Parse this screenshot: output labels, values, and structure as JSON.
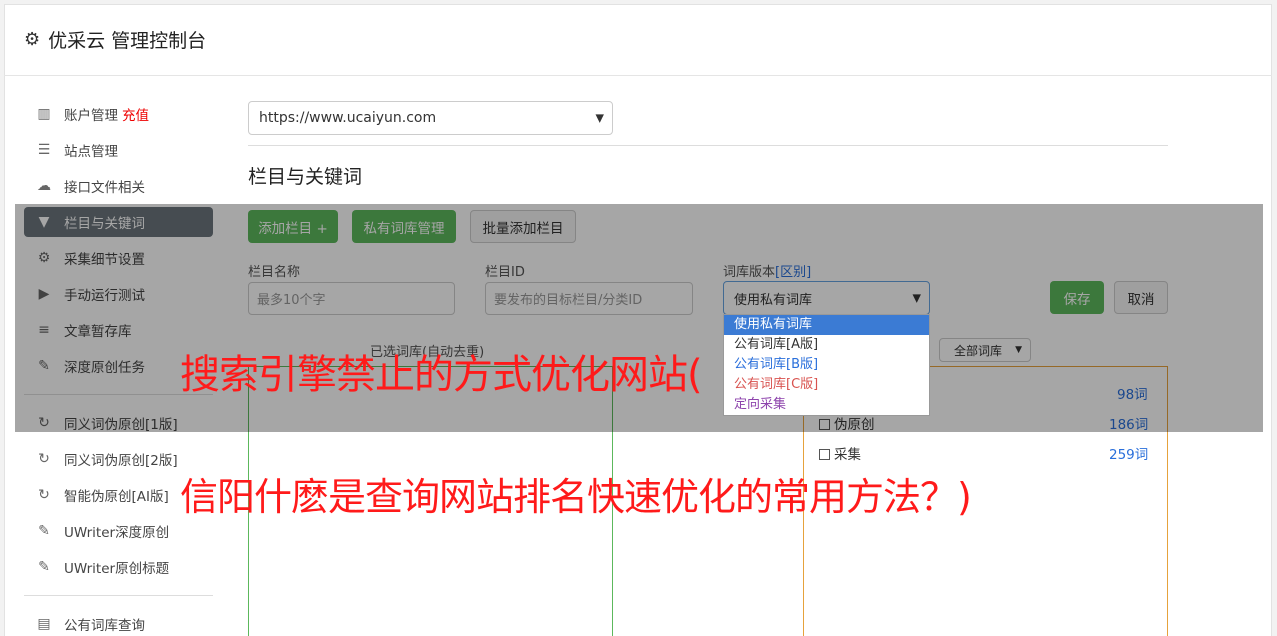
{
  "header": {
    "title": "优采云 管理控制台"
  },
  "sidebar": {
    "items": [
      {
        "label": "账户管理",
        "extra": "充值"
      },
      {
        "label": "站点管理"
      },
      {
        "label": "接口文件相关"
      },
      {
        "label": "栏目与关键词"
      },
      {
        "label": "采集细节设置"
      },
      {
        "label": "手动运行测试"
      },
      {
        "label": "文章暂存库"
      },
      {
        "label": "深度原创任务"
      },
      {
        "label": "同义词伪原创[1版]"
      },
      {
        "label": "同义词伪原创[2版]"
      },
      {
        "label": "智能伪原创[AI版]"
      },
      {
        "label": "UWriter深度原创"
      },
      {
        "label": "UWriter原创标题"
      },
      {
        "label": "公有词库查询"
      }
    ]
  },
  "site_select": {
    "value": "https://www.ucaiyun.com"
  },
  "section_title": "栏目与关键词",
  "buttons": {
    "add_column": "添加栏目 +",
    "private_lib": "私有词库管理",
    "batch_add": "批量添加栏目",
    "save": "保存",
    "cancel": "取消"
  },
  "form": {
    "name_label": "栏目名称",
    "name_placeholder": "最多10个字",
    "id_label": "栏目ID",
    "id_placeholder": "要发布的目标栏目/分类ID",
    "lib_label": "词库版本",
    "lib_label_link": "[区别]",
    "lib_value": "使用私有词库",
    "lib_options": [
      "使用私有词库",
      "公有词库[A版]",
      "公有词库[B版]",
      "公有词库[C版]",
      "定向采集"
    ]
  },
  "selected_lib_label": "已选词库(自动去重)",
  "all_lib_select": "全部词库",
  "lib_list": [
    {
      "name": "",
      "count": "98词"
    },
    {
      "name": "伪原创",
      "count": "186词"
    },
    {
      "name": "采集",
      "count": "259词"
    }
  ],
  "watermark": {
    "line1": "搜索引擎禁止的方式优化网站(",
    "line2": "信阳什麽是查询网站排名快速优化的常用方法？)"
  }
}
